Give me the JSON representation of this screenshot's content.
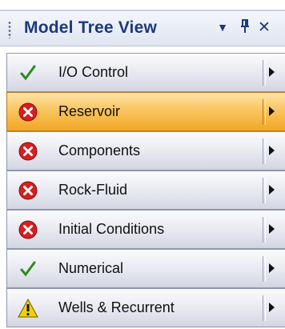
{
  "window": {
    "title": "Model Tree View",
    "icons": {
      "dropdown": "triangle-down-icon",
      "pin": "pin-icon",
      "close": "close-icon"
    },
    "glyphs": {
      "dropdown": "▼",
      "pin": "%",
      "close": "✕"
    }
  },
  "items": [
    {
      "label": "I/O Control",
      "status": "ok",
      "status_icon": "checkmark-icon",
      "selected": false
    },
    {
      "label": "Reservoir",
      "status": "error",
      "status_icon": "error-icon",
      "selected": true
    },
    {
      "label": "Components",
      "status": "error",
      "status_icon": "error-icon",
      "selected": false
    },
    {
      "label": "Rock-Fluid",
      "status": "error",
      "status_icon": "error-icon",
      "selected": false
    },
    {
      "label": "Initial Conditions",
      "status": "error",
      "status_icon": "error-icon",
      "selected": false
    },
    {
      "label": "Numerical",
      "status": "ok",
      "status_icon": "checkmark-icon",
      "selected": false
    },
    {
      "label": "Wells & Recurrent",
      "status": "warning",
      "status_icon": "warning-icon",
      "selected": false
    }
  ],
  "colors": {
    "title_text": "#1a3a7a",
    "selection": "#f8c35a",
    "ok": "#2e8b1e",
    "error": "#d81e1e",
    "warning": "#f5d000"
  }
}
